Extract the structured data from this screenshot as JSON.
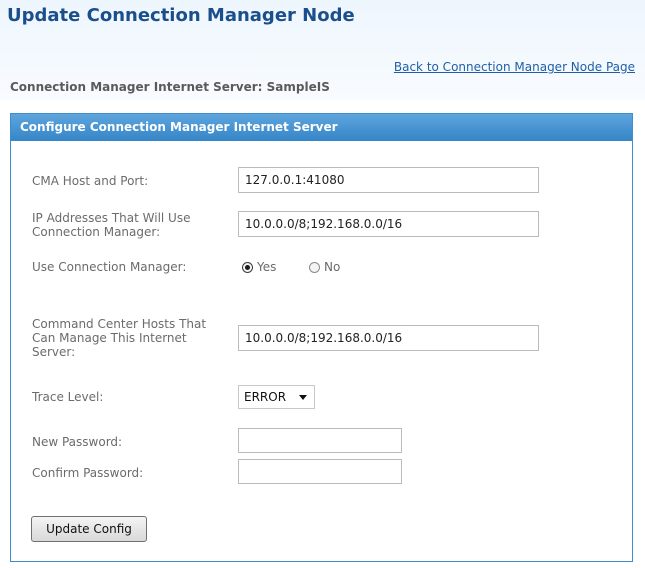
{
  "page": {
    "title": "Update Connection Manager Node",
    "back_link": "Back to Connection Manager Node Page",
    "server_line": "Connection Manager Internet Server: SampleIS"
  },
  "panel": {
    "header": "Configure Connection Manager Internet Server",
    "fields": {
      "cma_host_port": {
        "label": "CMA Host and Port:",
        "value": "127.0.0.1:41080"
      },
      "ip_addresses": {
        "label": "IP Addresses That Will Use Connection Manager:",
        "value": "10.0.0.0/8;192.168.0.0/16"
      },
      "use_connection_manager": {
        "label": "Use Connection Manager:",
        "options": [
          "Yes",
          "No"
        ],
        "selected": "Yes"
      },
      "command_center_hosts": {
        "label": "Command Center Hosts That Can Manage This Internet Server:",
        "value": "10.0.0.0/8;192.168.0.0/16"
      },
      "trace_level": {
        "label": "Trace Level:",
        "value": "ERROR"
      },
      "new_password": {
        "label": "New Password:",
        "value": ""
      },
      "confirm_password": {
        "label": "Confirm Password:",
        "value": ""
      }
    },
    "submit_label": "Update Config"
  },
  "icons": {
    "trace_dropdown": "chevron-down-icon",
    "radio_yes": "radio-checked-icon",
    "radio_no": "radio-unchecked-icon"
  }
}
